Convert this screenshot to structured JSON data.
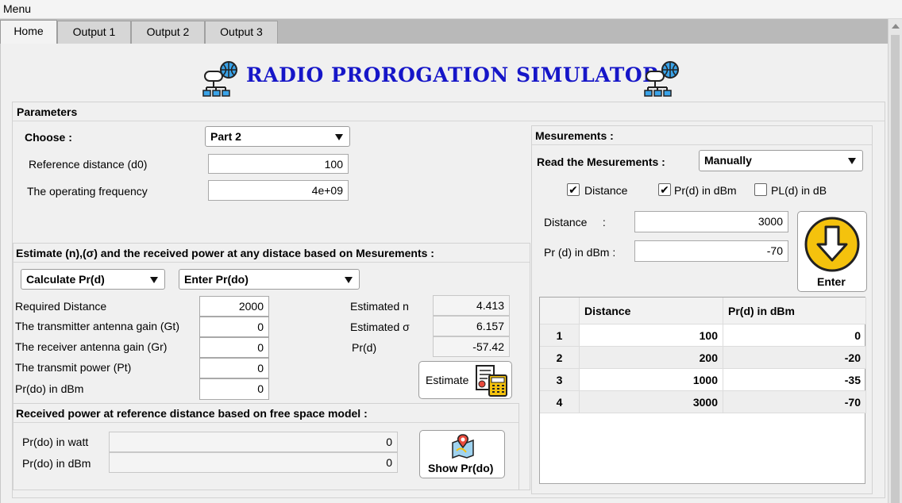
{
  "menu": {
    "label": "Menu"
  },
  "tabs": [
    "Home",
    "Output 1",
    "Output 2",
    "Output 3"
  ],
  "title": "RADIO PROROGATION SIMULATOR",
  "parameters": {
    "heading": "Parameters",
    "choose_label": "Choose :",
    "choose_value": "Part 2",
    "ref_distance_label": "Reference distance (d0)",
    "ref_distance_value": "100",
    "frequency_label": "The operating frequency",
    "frequency_value": "4e+09"
  },
  "estimate": {
    "heading": "Estimate (n),(σ) and the received power at any distace based on Mesurements :",
    "calc_combo": "Calculate Pr(d)",
    "enter_combo": "Enter Pr(do)",
    "inputs": [
      {
        "label": "Required Distance",
        "value": "2000"
      },
      {
        "label": "The transmitter antenna gain (Gt)",
        "value": "0"
      },
      {
        "label": "The receiver antenna gain (Gr)",
        "value": "0"
      },
      {
        "label": "The transmit power (Pt)",
        "value": "0"
      },
      {
        "label": "Pr(do) in dBm",
        "value": "0"
      }
    ],
    "results": [
      {
        "label": "Estimated n",
        "value": "4.413"
      },
      {
        "label": "Estimated σ",
        "value": "6.157"
      },
      {
        "label": "Pr(d)",
        "value": "-57.42"
      }
    ],
    "button": "Estimate"
  },
  "free_space": {
    "heading": "Received power at reference distance based on free space model :",
    "watt_label": "Pr(do) in watt",
    "watt_value": "0",
    "dbm_label": "Pr(do) in dBm",
    "dbm_value": "0",
    "button": "Show Pr(do)"
  },
  "measurements": {
    "heading": "Mesurements :",
    "read_label": "Read the Mesurements :",
    "read_value": "Manually",
    "checks": [
      {
        "label": "Distance",
        "checked": true
      },
      {
        "label": "Pr(d) in dBm",
        "checked": true
      },
      {
        "label": "PL(d) in dB",
        "checked": false
      }
    ],
    "distance_label": "Distance     :",
    "distance_value": "3000",
    "pr_label": "Pr (d) in dBm :",
    "pr_value": "-70",
    "enter_button": "Enter",
    "table": {
      "columns": [
        "",
        "Distance",
        "Pr(d) in dBm"
      ],
      "rows": [
        [
          "1",
          "100",
          "0"
        ],
        [
          "2",
          "200",
          "-20"
        ],
        [
          "3",
          "1000",
          "-35"
        ],
        [
          "4",
          "3000",
          "-70"
        ]
      ]
    }
  },
  "colors": {
    "title": "#1616c8",
    "enter_icon": "#f4c20d"
  },
  "icons": [
    "network-globe-icon",
    "calculator-icon",
    "map-pin-icon",
    "arrow-down-icon",
    "scroll-up-icon"
  ]
}
